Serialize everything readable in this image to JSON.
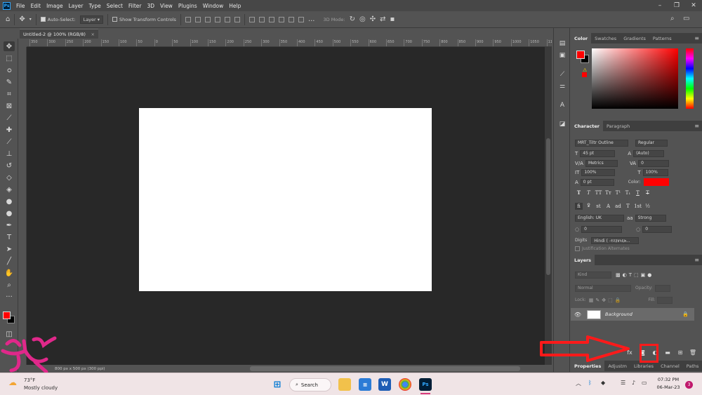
{
  "menubar": {
    "app_icon": "Ps",
    "items": [
      "File",
      "Edit",
      "Image",
      "Layer",
      "Type",
      "Select",
      "Filter",
      "3D",
      "View",
      "Plugins",
      "Window",
      "Help"
    ]
  },
  "options_bar": {
    "auto_select_label": "Auto-Select:",
    "auto_select_value": "Layer",
    "show_transform_label": "Show Transform Controls",
    "mode_3d_label": "3D Mode:",
    "more_label": "..."
  },
  "document": {
    "tab_title": "Untitled-2 @ 100% (RGB/8)",
    "close": "×",
    "status": "800 px x 500 px (300 ppi)"
  },
  "ruler_ticks": [
    "350",
    "300",
    "250",
    "200",
    "150",
    "100",
    "50",
    "0",
    "50",
    "100",
    "150",
    "200",
    "250",
    "300",
    "350",
    "400",
    "450",
    "500",
    "550",
    "600",
    "650",
    "700",
    "750",
    "800",
    "850",
    "900",
    "950",
    "1000",
    "1050",
    "1100",
    "1150"
  ],
  "color_panel": {
    "tabs": [
      "Color",
      "Swatches",
      "Gradients",
      "Patterns"
    ],
    "foreground": "#ff0000",
    "background": "#000000"
  },
  "character_panel": {
    "tabs": [
      "Character",
      "Paragraph"
    ],
    "font_family": "MRT_Tiltr Outline",
    "font_style": "Regular",
    "font_size": "45 pt",
    "leading": "(Auto)",
    "kerning": "Metrics",
    "tracking": "0",
    "vertical_scale": "100%",
    "horizontal_scale": "100%",
    "baseline_shift": "0 pt",
    "color_label": "Color:",
    "color": "#ff0000",
    "type_buttons": [
      "T",
      "T",
      "TT",
      "Tт",
      "T¹",
      "T₁",
      "T",
      "T"
    ],
    "opentype_buttons": [
      "fi",
      "ꝿ",
      "st",
      "A",
      "ad",
      "T",
      "1st",
      "½"
    ],
    "language": "English: UK",
    "antialias_icon": "aa",
    "antialias": "Strong",
    "opt1": "0",
    "opt2": "0",
    "digits_label": "Digits",
    "digits_value": "Hindi ( -१२३४५६७...",
    "justification": "Justification Alternates"
  },
  "layers_panel": {
    "tab": "Layers",
    "kind_label": "Kind",
    "blend_mode": "Normal",
    "opacity_label": "Opacity:",
    "lock_label": "Lock:",
    "fill_label": "Fill:",
    "layer_name": "Background",
    "bottom_tabs": [
      "Properties",
      "Adjustm",
      "Libraries",
      "Channel",
      "Paths"
    ]
  },
  "taskbar": {
    "weather_temp": "73°F",
    "weather_desc": "Mostly cloudy",
    "search_label": "Search",
    "time": "07:32 PM",
    "date": "06-Mar-23",
    "notifications": "3"
  }
}
